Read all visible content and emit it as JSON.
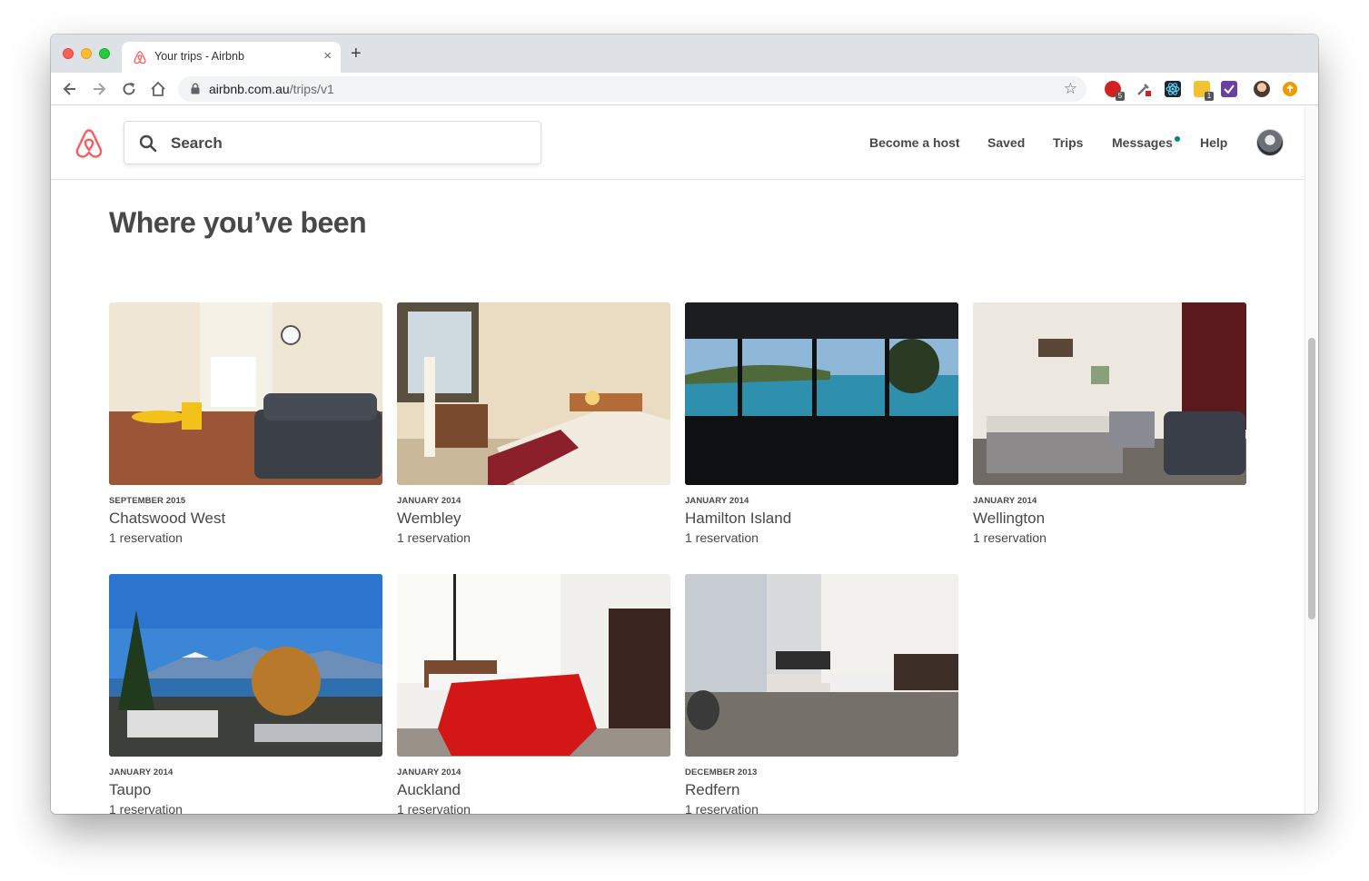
{
  "browser": {
    "tab_title": "Your trips - Airbnb",
    "tab_close": "×",
    "new_tab": "+",
    "url_host": "airbnb.com.au",
    "url_path": "/trips/v1",
    "extensions": [
      {
        "name": "opera-extension",
        "color": "#d42020",
        "badge": "5"
      },
      {
        "name": "eyedropper-extension",
        "color": "#8a8f95",
        "badge": ""
      },
      {
        "name": "react-devtools-extension",
        "color": "#1e6fb8",
        "badge": ""
      },
      {
        "name": "note-extension",
        "color": "#f2c230",
        "badge": "1"
      },
      {
        "name": "purple-extension",
        "color": "#6b3fa0",
        "badge": ""
      }
    ]
  },
  "site": {
    "brand_color": "#ff5a5f",
    "search_placeholder": "Search",
    "nav": {
      "become_host": "Become a host",
      "saved": "Saved",
      "trips": "Trips",
      "messages": "Messages",
      "help": "Help"
    }
  },
  "page": {
    "heading": "Where you’ve been",
    "trips": [
      {
        "date": "SEPTEMBER 2015",
        "city": "Chatswood West",
        "count": "1 reservation",
        "photo": "room-yellow-chairs"
      },
      {
        "date": "JANUARY 2014",
        "city": "Wembley",
        "count": "1 reservation",
        "photo": "bedroom-window"
      },
      {
        "date": "JANUARY 2014",
        "city": "Hamilton Island",
        "count": "1 reservation",
        "photo": "ocean-view-living-room"
      },
      {
        "date": "JANUARY 2014",
        "city": "Wellington",
        "count": "1 reservation",
        "photo": "bedroom-red-curtain"
      },
      {
        "date": "JANUARY 2014",
        "city": "Taupo",
        "count": "1 reservation",
        "photo": "lake-mountains-town"
      },
      {
        "date": "JANUARY 2014",
        "city": "Auckland",
        "count": "1 reservation",
        "photo": "bedroom-red-duvet"
      },
      {
        "date": "DECEMBER 2013",
        "city": "Redfern",
        "count": "1 reservation",
        "photo": "bright-living-room"
      }
    ]
  }
}
